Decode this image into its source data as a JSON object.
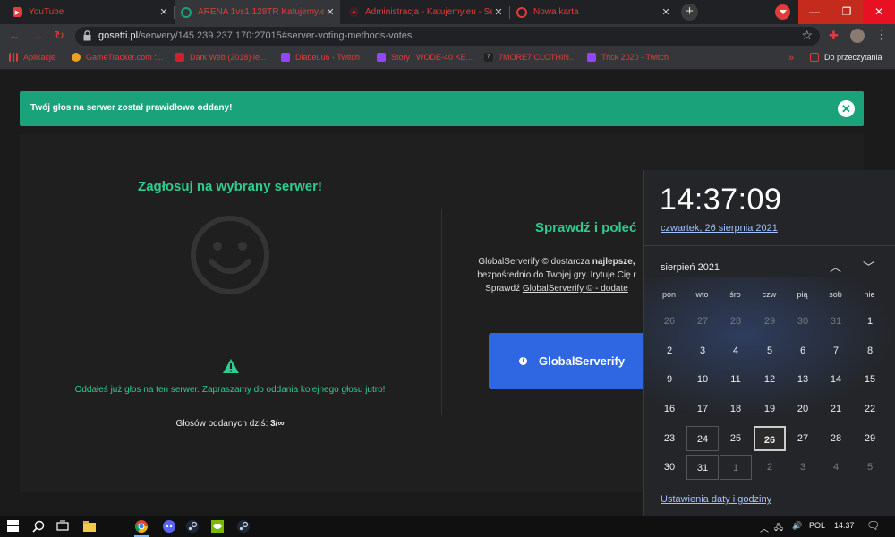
{
  "browser": {
    "tabs": [
      {
        "title": "YouTube",
        "icon": "youtube-icon"
      },
      {
        "title": "ARENA 1vs1 128TR Katujemy.eu «",
        "icon": "crosshair-icon"
      },
      {
        "title": "Administracja - Katujemy.eu - Se",
        "icon": "katujemy-icon"
      },
      {
        "title": "Nowa karta",
        "icon": "globe-icon"
      }
    ],
    "tab_close_glyph": "✕",
    "new_tab_glyph": "+",
    "window_minimize": "—",
    "window_restore": "❐",
    "window_close": "✕",
    "url_host": "gosetti.pl",
    "url_path": "/serwery/145.239.237.170:27015#server-voting-methods-votes",
    "bookmarks": [
      {
        "label": "Aplikacje",
        "icon": "apps-grid-icon"
      },
      {
        "label": "GameTracker.com :...",
        "icon": "gametracker-icon"
      },
      {
        "label": "Dark Web (2018) le...",
        "icon": "cda-icon"
      },
      {
        "label": "Diabeuu6 - Twitch",
        "icon": "twitch-icon"
      },
      {
        "label": "Story i WODE-40 KE...",
        "icon": "twitch-icon"
      },
      {
        "label": "7MORE7 CLOTHIN...",
        "icon": "7more7-icon"
      },
      {
        "label": "Trick 2020 - Twitch",
        "icon": "twitch-icon"
      }
    ],
    "bookmarks_overflow": "»",
    "reading_list": "Do przeczytania"
  },
  "page": {
    "alert": "Twój głos na serwer został prawidłowo oddany!",
    "vote_title": "Zagłosuj na wybrany serwer!",
    "voted_message": "Oddałeś już głos na ten serwer. Zapraszamy do oddania kolejnego głosu jutro!",
    "votes_today_label": "Głosów oddanych dziś:",
    "votes_today_value": "3/∞",
    "check_title": "Sprawdź i poleć",
    "desc_line1_a": "GlobalServerify © dostarcza ",
    "desc_line1_b": "najlepsze,",
    "desc_line2": "bezpośrednio do Twojej gry. Irytuje Cię r",
    "desc_line3_a": "Sprawdź ",
    "desc_line3_link": "GlobalServerify © - dodate",
    "button_label": "GlobalServerify",
    "colors": {
      "accent_green": "#2ecc8f",
      "alert_green": "#1aa37a",
      "button_blue": "#2f66e2",
      "brand_red": "#e23b3b"
    }
  },
  "clock": {
    "time": "14:37:09",
    "date": "czwartek, 26 sierpnia 2021",
    "month": "sierpień 2021",
    "weekdays": [
      "pon",
      "wto",
      "śro",
      "czw",
      "pią",
      "sob",
      "nie"
    ],
    "weeks": [
      [
        "26",
        "27",
        "28",
        "29",
        "30",
        "31",
        "1"
      ],
      [
        "2",
        "3",
        "4",
        "5",
        "6",
        "7",
        "8"
      ],
      [
        "9",
        "10",
        "11",
        "12",
        "13",
        "14",
        "15"
      ],
      [
        "16",
        "17",
        "18",
        "19",
        "20",
        "21",
        "22"
      ],
      [
        "23",
        "24",
        "25",
        "26",
        "27",
        "28",
        "29"
      ],
      [
        "30",
        "31",
        "1",
        "2",
        "3",
        "4",
        "5"
      ]
    ],
    "today": "26",
    "settings_link": "Ustawienia daty i godziny"
  },
  "taskbar": {
    "icons": [
      "windows-start-icon",
      "search-icon",
      "task-view-icon",
      "file-explorer-icon",
      "chrome-icon",
      "discord-icon",
      "steam-icon",
      "nvidia-icon",
      "steam-icon"
    ],
    "language": "POL",
    "time": "14:37"
  }
}
